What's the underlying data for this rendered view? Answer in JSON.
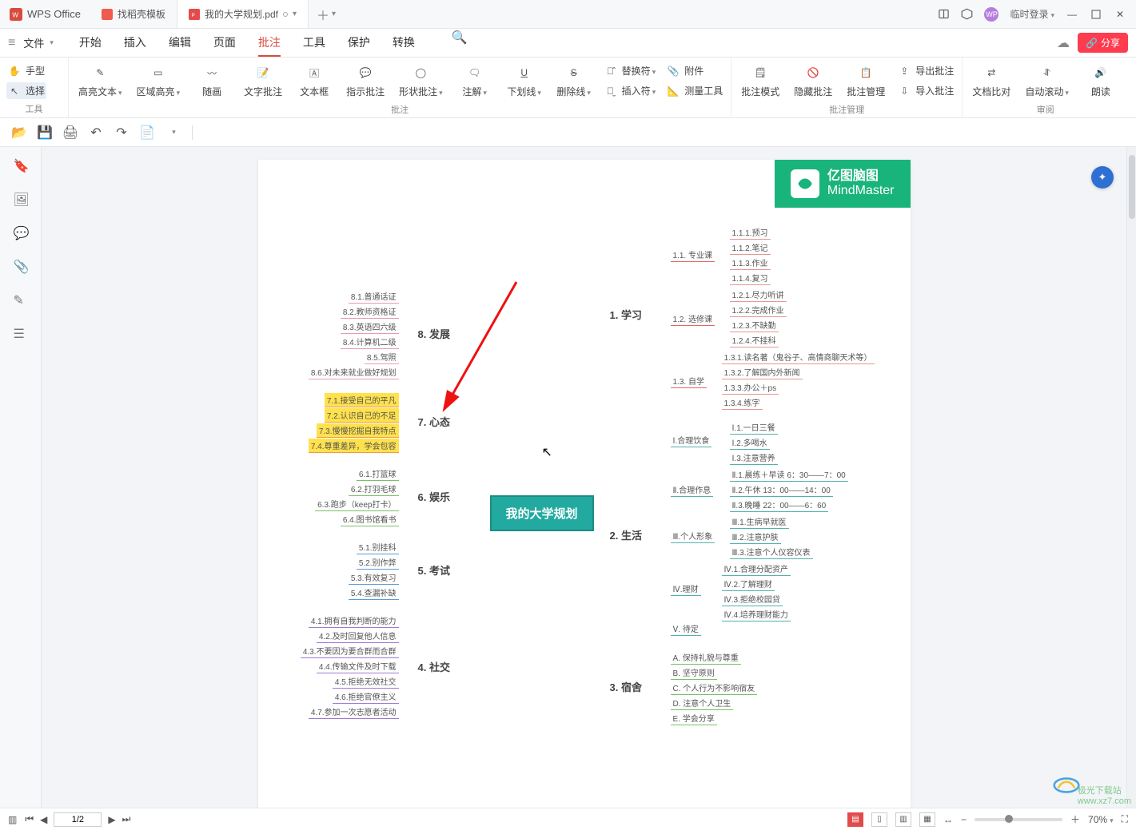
{
  "app": {
    "name": "WPS Office"
  },
  "tabs": [
    {
      "icon": "docer",
      "label": "找稻壳模板"
    },
    {
      "icon": "pdf",
      "label": "我的大学规划.pdf",
      "active": true
    }
  ],
  "titlebar_right": {
    "login": "临时登录"
  },
  "menu": {
    "file": "文件",
    "items": [
      "开始",
      "插入",
      "编辑",
      "页面",
      "批注",
      "工具",
      "保护",
      "转换"
    ],
    "active": "批注",
    "share": "分享"
  },
  "ribbon": {
    "g1": {
      "hand": "手型",
      "select": "选择",
      "label": "工具"
    },
    "g2": {
      "highlight_text": "高亮文本",
      "area_highlight": "区域高亮",
      "freehand": "随画",
      "text_annot": "文字批注",
      "text_box": "文本框",
      "pointer_annot": "指示批注",
      "shape_annot": "形状批注",
      "annotate": "注解",
      "underline": "下划线",
      "strike": "删除线",
      "replace": "替换符",
      "attachment": "附件",
      "insert_mark": "插入符",
      "measure": "测量工具",
      "label": "批注"
    },
    "g3": {
      "annot_mode": "批注模式",
      "hide_annot": "隐藏批注",
      "manage_annot": "批注管理",
      "export_annot": "导出批注",
      "import_annot": "导入批注",
      "label": "批注管理"
    },
    "g4": {
      "compare": "文档比对",
      "auto_scroll": "自动滚动",
      "read_aloud": "朗读",
      "label": "审阅"
    }
  },
  "mindmap": {
    "brand_cn": "亿图脑图",
    "brand_en": "MindMaster",
    "center": "我的大学规划",
    "r1": {
      "title": "1. 学习",
      "b1": {
        "title": "1.1. 专业课",
        "items": [
          "1.1.1.预习",
          "1.1.2.笔记",
          "1.1.3.作业",
          "1.1.4.复习"
        ]
      },
      "b2": {
        "title": "1.2. 选修课",
        "items": [
          "1.2.1.尽力听讲",
          "1.2.2.完成作业",
          "1.2.3.不缺勤",
          "1.2.4.不挂科"
        ]
      },
      "b3": {
        "title": "1.3. 自学",
        "items": [
          "1.3.1.读名著（鬼谷子、高情商聊天术等）",
          "1.3.2.了解国内外新闻",
          "1.3.3.办公＋ps",
          "1.3.4.练字"
        ]
      }
    },
    "r2": {
      "title": "2. 生活",
      "b1": {
        "title": "Ⅰ.合理饮食",
        "items": [
          "Ⅰ.1.一日三餐",
          "Ⅰ.2.多喝水",
          "Ⅰ.3.注意营养"
        ]
      },
      "b2": {
        "title": "Ⅱ.合理作息",
        "items": [
          "Ⅱ.1.晨练＋早读 6：30——7：00",
          "Ⅱ.2.午休 13：00——14：00",
          "Ⅱ.3.晚睡 22：00——6：60"
        ]
      },
      "b3": {
        "title": "Ⅲ.个人形象",
        "items": [
          "Ⅲ.1.生病早就医",
          "Ⅲ.2.注意护肤",
          "Ⅲ.3.注意个人仪容仪表"
        ]
      },
      "b4": {
        "title": "Ⅳ.理财",
        "items": [
          "Ⅳ.1.合理分配资产",
          "Ⅳ.2.了解理财",
          "Ⅳ.3.拒绝校园贷",
          "Ⅳ.4.培养理财能力"
        ]
      },
      "b5": {
        "title": "Ⅴ. 待定"
      }
    },
    "r3": {
      "title": "3. 宿舍",
      "items": [
        "A. 保持礼貌与尊重",
        "B. 坚守原则",
        "C. 个人行为不影响宿友",
        "D. 注意个人卫生",
        "E. 学会分享"
      ]
    },
    "l8": {
      "title": "8. 发展",
      "items": [
        "8.1.普通话证",
        "8.2.教师资格证",
        "8.3.英语四六级",
        "8.4.计算机二级",
        "8.5.驾照",
        "8.6.对未来就业做好规划"
      ]
    },
    "l7": {
      "title": "7. 心态",
      "items": [
        "7.1.接受自己的平凡",
        "7.2.认识自己的不足",
        "7.3.慢慢挖掘自我特点",
        "7.4.尊重差异，学会包容"
      ]
    },
    "l6": {
      "title": "6. 娱乐",
      "items": [
        "6.1.打篮球",
        "6.2.打羽毛球",
        "6.3.跑步（keep打卡）",
        "6.4.图书馆看书"
      ]
    },
    "l5": {
      "title": "5. 考试",
      "items": [
        "5.1.别挂科",
        "5.2.别作弊",
        "5.3.有效复习",
        "5.4.查漏补缺"
      ]
    },
    "l4": {
      "title": "4. 社交",
      "items": [
        "4.1.拥有自我判断的能力",
        "4.2.及时回复他人信息",
        "4.3.不要因为要合群而合群",
        "4.4.传输文件及时下载",
        "4.5.拒绝无效社交",
        "4.6.拒绝官僚主义",
        "4.7.参加一次志愿者活动"
      ]
    }
  },
  "status": {
    "page": "1/2",
    "zoom": "70%",
    "watermark": "www.xz7.com",
    "watermark2": "极光下载站"
  }
}
